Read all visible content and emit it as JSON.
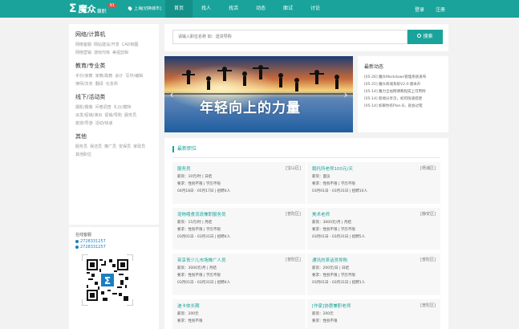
{
  "header": {
    "logo_mark": "Σ",
    "logo_text": "魔众",
    "logo_badge": "91",
    "logo_sub": "兼职",
    "city": "上海[切换城市]",
    "nav": [
      "首页",
      "找人",
      "找活",
      "动态",
      "面试",
      "讨论"
    ],
    "login": "登录",
    "register": "注册"
  },
  "sidebar": {
    "categories": [
      {
        "title": "网络/计算机",
        "links": [
          "网络客服",
          "网站建设/开发",
          "CAD制图",
          "网络营销",
          "游戏代练",
          "美视剪辑"
        ]
      },
      {
        "title": "教育/专业类",
        "links": [
          "手抄/家教",
          "家教/助教",
          "会计",
          "写作/编辑",
          "律师/法务",
          "翻译",
          "化妆师"
        ]
      },
      {
        "title": "线下/活动类",
        "links": [
          "摄影/摄像",
          "问卷调查",
          "礼仪/模特",
          "派发/促销/演出",
          "促销/导购",
          "服务员",
          "旅游/导游",
          "活动/快递"
        ]
      },
      {
        "title": "其他",
        "links": [
          "服务员",
          "保洁员",
          "推广员",
          "安保员",
          "家政员",
          "其他职位"
        ]
      }
    ],
    "customer_service": {
      "title": "在线客服",
      "qq": [
        "2728331257",
        "2728331257"
      ]
    }
  },
  "search": {
    "placeholder": "请输入职位名称 如：送货导购",
    "button": "搜索"
  },
  "banner": {
    "text": "年轻向上的力量"
  },
  "news": {
    "title": "最新动态",
    "items": [
      "[05-26] 魔众Markdown管理系统发布",
      "[05-25] 魔众商城系统V2.0-版本升",
      "[05-14] 魔力全站网课教程成上可用例",
      "[05-14] 新闻分享页，如何快速搭建",
      "[05-14] 如果你有Plan B，就会过错"
    ]
  },
  "jobs": {
    "header": "最新职位",
    "items": [
      {
        "title": "服务员",
        "area": "[宝山区]",
        "salary": "薪资：10元/时 | 日结",
        "req": "要求：性别不限 | 学历不限",
        "time": "04月18日 - 05月17日 | 招聘4人"
      },
      {
        "title": "鹅托所老师100元/天",
        "area": "[杨浦区]",
        "salary": "薪资：面议",
        "req": "要求：性别不限 | 学历不限",
        "time": "03月01日 - 03月31日 | 招聘10人"
      },
      {
        "title": "宠物喂食流浪兼职服务员",
        "area": "[普陀区]",
        "salary": "薪资：15元/时 | 月结",
        "req": "要求：性别不限 | 学历不限",
        "time": "03月01日 - 03月31日 | 招聘4人"
      },
      {
        "title": "美术老师",
        "area": "[静安区]",
        "salary": "薪资：3000元/月 | 月结",
        "req": "要求：性别不限 | 学历不限",
        "time": "03月01日 - 03月31日 | 招聘5人"
      },
      {
        "title": "英享青少儿市场推广人员",
        "area": "[普陀区]",
        "salary": "薪资：3000元/月 | 月结",
        "req": "要求：性别不限 | 学历不限",
        "time": "03月01日 - 03月31日 | 招聘4人"
      },
      {
        "title": "通讯的茶话员导购",
        "area": "[普陀区]",
        "salary": "薪资：200元/日 | 日结",
        "req": "要求：性别不限 | 学历不限",
        "time": "03月01日 - 03月31日 | 招聘1人"
      },
      {
        "title": "迪卡侬长期",
        "area": "",
        "salary": "薪资：200元",
        "req": "要求：性别不限",
        "time": ""
      },
      {
        "title": "[作家]协惠兼职老师",
        "area": "[普陀区]",
        "salary": "薪资：200元",
        "req": "要求：性别不限",
        "time": ""
      }
    ]
  },
  "colors": {
    "brand": "#1aa39a",
    "nav_active": "#149088",
    "link": "#1a7fc1"
  }
}
